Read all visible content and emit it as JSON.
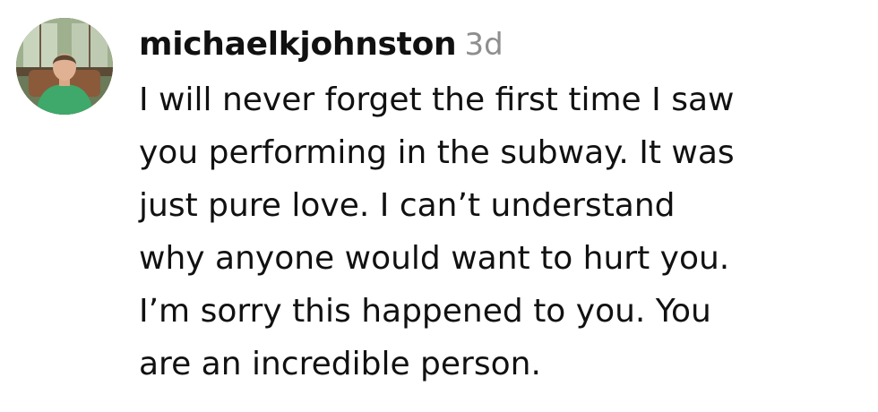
{
  "comment": {
    "username": "michaelkjohnston",
    "timestamp": "3d",
    "avatar_icon": "user-photo-avatar",
    "text_lines": [
      "I will never forget the first time I saw",
      "you performing in the subway. It was",
      "just pure love. I can’t understand",
      "why anyone would want to hurt you.",
      "I’m sorry this happened to you. You",
      "are an incredible person."
    ]
  },
  "colors": {
    "text": "#111111",
    "timestamp": "#8e8e8e",
    "background": "#ffffff"
  }
}
